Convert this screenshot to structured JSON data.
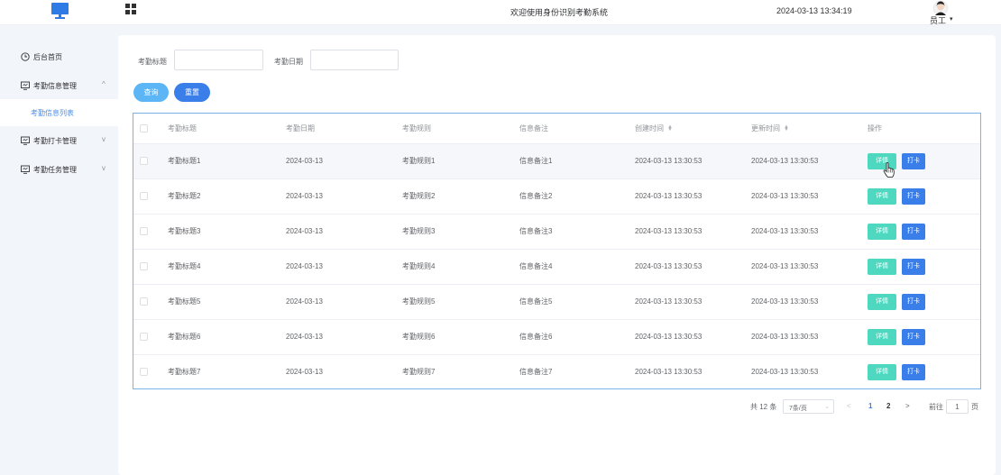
{
  "header": {
    "welcome": "欢迎使用身份识别考勤系统",
    "datetime": "2024-03-13 13:34:19",
    "user_name": "员工",
    "user_caret": "▾"
  },
  "sidebar": {
    "items": [
      {
        "label": "后台首页",
        "icon": "clock-icon",
        "chevron": ""
      },
      {
        "label": "考勤信息管理",
        "icon": "monitor-icon",
        "chevron": "^"
      },
      {
        "label": "考勤打卡管理",
        "icon": "monitor-icon",
        "chevron": "v"
      },
      {
        "label": "考勤任务管理",
        "icon": "monitor-icon",
        "chevron": "v"
      }
    ],
    "active_sub": "考勤信息列表"
  },
  "filters": {
    "title_label": "考勤标题",
    "title_value": "",
    "date_label": "考勤日期",
    "date_value": "",
    "query_label": "查询",
    "reset_label": "重置"
  },
  "table": {
    "headers": {
      "title": "考勤标题",
      "date": "考勤日期",
      "rule": "考勤规则",
      "remark": "信息备注",
      "created": "创建时间",
      "updated": "更新时间",
      "ops": "操作"
    },
    "detail_label": "详情",
    "punch_label": "打卡",
    "rows": [
      {
        "title": "考勤标题1",
        "date": "2024-03-13",
        "rule": "考勤规则1",
        "remark": "信息备注1",
        "created": "2024-03-13 13:30:53",
        "updated": "2024-03-13 13:30:53"
      },
      {
        "title": "考勤标题2",
        "date": "2024-03-13",
        "rule": "考勤规则2",
        "remark": "信息备注2",
        "created": "2024-03-13 13:30:53",
        "updated": "2024-03-13 13:30:53"
      },
      {
        "title": "考勤标题3",
        "date": "2024-03-13",
        "rule": "考勤规则3",
        "remark": "信息备注3",
        "created": "2024-03-13 13:30:53",
        "updated": "2024-03-13 13:30:53"
      },
      {
        "title": "考勤标题4",
        "date": "2024-03-13",
        "rule": "考勤规则4",
        "remark": "信息备注4",
        "created": "2024-03-13 13:30:53",
        "updated": "2024-03-13 13:30:53"
      },
      {
        "title": "考勤标题5",
        "date": "2024-03-13",
        "rule": "考勤规则5",
        "remark": "信息备注5",
        "created": "2024-03-13 13:30:53",
        "updated": "2024-03-13 13:30:53"
      },
      {
        "title": "考勤标题6",
        "date": "2024-03-13",
        "rule": "考勤规则6",
        "remark": "信息备注6",
        "created": "2024-03-13 13:30:53",
        "updated": "2024-03-13 13:30:53"
      },
      {
        "title": "考勤标题7",
        "date": "2024-03-13",
        "rule": "考勤规则7",
        "remark": "信息备注7",
        "created": "2024-03-13 13:30:53",
        "updated": "2024-03-13 13:30:53"
      }
    ]
  },
  "pagination": {
    "total": "共 12 条",
    "page_size": "7条/页",
    "prev": "<",
    "pages": [
      "1",
      "2"
    ],
    "current_page": "1",
    "next": ">",
    "goto_label": "前往",
    "goto_value": "1",
    "goto_suffix": "页"
  },
  "colors": {
    "primary": "#3a7ee9",
    "query_button": "#5cb6f5",
    "detail_button": "#4fd8c0",
    "table_border": "#7ab3e6",
    "active_menu_text": "#4d8fe8"
  }
}
